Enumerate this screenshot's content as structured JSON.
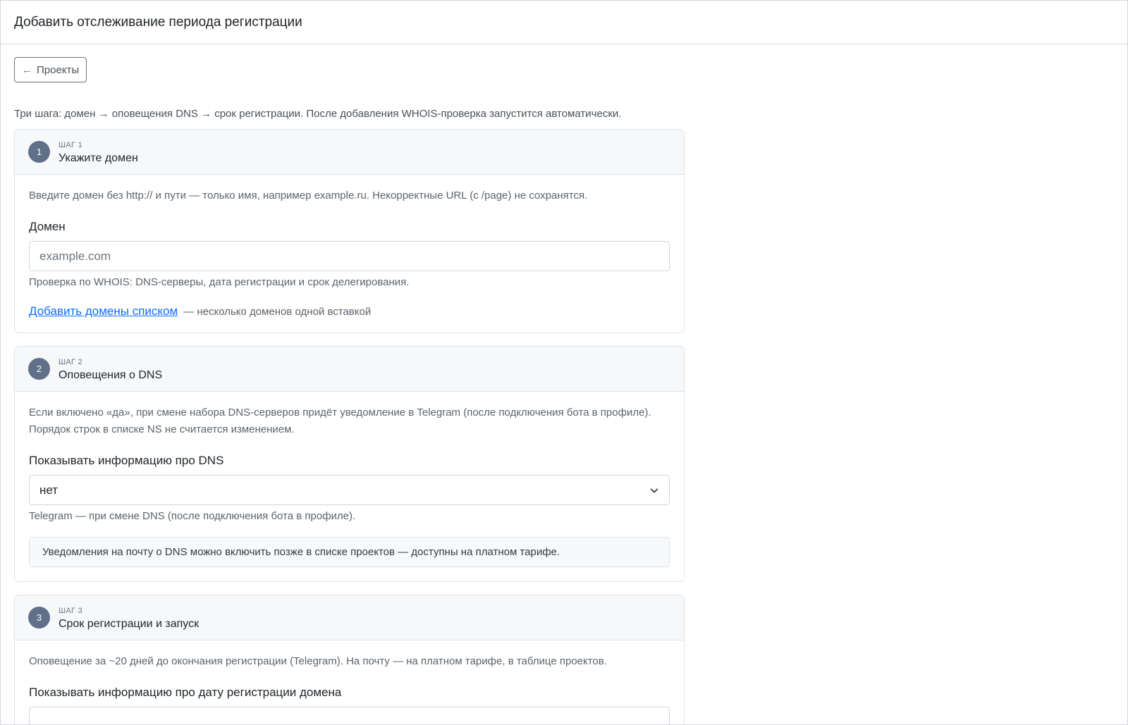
{
  "header": {
    "title": "Добавить отслеживание периода регистрации"
  },
  "back_button": {
    "label": "Проекты",
    "arrow": "←"
  },
  "intro": "Три шага: домен → оповещения DNS → срок регистрации. После добавления WHOIS-проверка запустится автоматически.",
  "steps": [
    {
      "number": "1",
      "kicker": "ШАГ 1",
      "title": "Укажите домен",
      "description": "Введите домен без http:// и пути — только имя, например example.ru. Некорректные URL (с /page) не сохранятся.",
      "field_label": "Домен",
      "field_placeholder": "example.com",
      "help": "Проверка по WHOIS: DNS-серверы, дата регистрации и срок делегирования.",
      "link_label": "Добавить домены списком",
      "link_suffix": "— несколько доменов одной вставкой"
    },
    {
      "number": "2",
      "kicker": "ШАГ 2",
      "title": "Оповещения о DNS",
      "description_line1": "Если включено «да», при смене набора DNS-серверов придёт уведомление в Telegram (после подключения бота в профиле).",
      "description_line2": "Порядок строк в списке NS не считается изменением.",
      "field_label": "Показывать информацию про DNS",
      "select_value": "нет",
      "help": "Telegram — при смене DNS (после подключения бота в профиле).",
      "note": "Уведомления на почту о DNS можно включить позже в списке проектов — доступны на платном тарифе."
    },
    {
      "number": "3",
      "kicker": "ШАГ 3",
      "title": "Срок регистрации и запуск",
      "description": "Оповещение за ~20 дней до окончания регистрации (Telegram). На почту — на платном тарифе, в таблице проектов.",
      "field_label": "Показывать информацию про дату регистрации домена"
    }
  ]
}
